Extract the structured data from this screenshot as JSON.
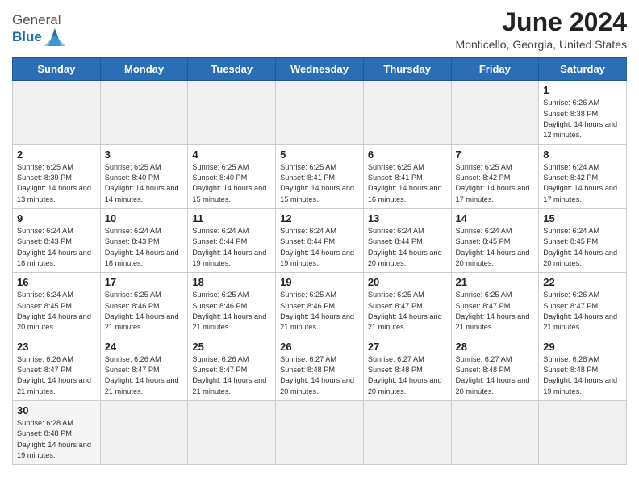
{
  "header": {
    "logo_general": "General",
    "logo_blue": "Blue",
    "month_title": "June 2024",
    "location": "Monticello, Georgia, United States"
  },
  "weekdays": [
    "Sunday",
    "Monday",
    "Tuesday",
    "Wednesday",
    "Thursday",
    "Friday",
    "Saturday"
  ],
  "weeks": [
    [
      {
        "day": "",
        "empty": true
      },
      {
        "day": "",
        "empty": true
      },
      {
        "day": "",
        "empty": true
      },
      {
        "day": "",
        "empty": true
      },
      {
        "day": "",
        "empty": true
      },
      {
        "day": "",
        "empty": true
      },
      {
        "day": "1",
        "sunrise": "Sunrise: 6:26 AM",
        "sunset": "Sunset: 8:38 PM",
        "daylight": "Daylight: 14 hours and 12 minutes."
      }
    ],
    [
      {
        "day": "2",
        "sunrise": "Sunrise: 6:25 AM",
        "sunset": "Sunset: 8:39 PM",
        "daylight": "Daylight: 14 hours and 13 minutes."
      },
      {
        "day": "3",
        "sunrise": "Sunrise: 6:25 AM",
        "sunset": "Sunset: 8:40 PM",
        "daylight": "Daylight: 14 hours and 14 minutes."
      },
      {
        "day": "4",
        "sunrise": "Sunrise: 6:25 AM",
        "sunset": "Sunset: 8:40 PM",
        "daylight": "Daylight: 14 hours and 15 minutes."
      },
      {
        "day": "5",
        "sunrise": "Sunrise: 6:25 AM",
        "sunset": "Sunset: 8:41 PM",
        "daylight": "Daylight: 14 hours and 15 minutes."
      },
      {
        "day": "6",
        "sunrise": "Sunrise: 6:25 AM",
        "sunset": "Sunset: 8:41 PM",
        "daylight": "Daylight: 14 hours and 16 minutes."
      },
      {
        "day": "7",
        "sunrise": "Sunrise: 6:25 AM",
        "sunset": "Sunset: 8:42 PM",
        "daylight": "Daylight: 14 hours and 17 minutes."
      },
      {
        "day": "8",
        "sunrise": "Sunrise: 6:24 AM",
        "sunset": "Sunset: 8:42 PM",
        "daylight": "Daylight: 14 hours and 17 minutes."
      }
    ],
    [
      {
        "day": "9",
        "sunrise": "Sunrise: 6:24 AM",
        "sunset": "Sunset: 8:43 PM",
        "daylight": "Daylight: 14 hours and 18 minutes."
      },
      {
        "day": "10",
        "sunrise": "Sunrise: 6:24 AM",
        "sunset": "Sunset: 8:43 PM",
        "daylight": "Daylight: 14 hours and 18 minutes."
      },
      {
        "day": "11",
        "sunrise": "Sunrise: 6:24 AM",
        "sunset": "Sunset: 8:44 PM",
        "daylight": "Daylight: 14 hours and 19 minutes."
      },
      {
        "day": "12",
        "sunrise": "Sunrise: 6:24 AM",
        "sunset": "Sunset: 8:44 PM",
        "daylight": "Daylight: 14 hours and 19 minutes."
      },
      {
        "day": "13",
        "sunrise": "Sunrise: 6:24 AM",
        "sunset": "Sunset: 8:44 PM",
        "daylight": "Daylight: 14 hours and 20 minutes."
      },
      {
        "day": "14",
        "sunrise": "Sunrise: 6:24 AM",
        "sunset": "Sunset: 8:45 PM",
        "daylight": "Daylight: 14 hours and 20 minutes."
      },
      {
        "day": "15",
        "sunrise": "Sunrise: 6:24 AM",
        "sunset": "Sunset: 8:45 PM",
        "daylight": "Daylight: 14 hours and 20 minutes."
      }
    ],
    [
      {
        "day": "16",
        "sunrise": "Sunrise: 6:24 AM",
        "sunset": "Sunset: 8:45 PM",
        "daylight": "Daylight: 14 hours and 20 minutes."
      },
      {
        "day": "17",
        "sunrise": "Sunrise: 6:25 AM",
        "sunset": "Sunset: 8:46 PM",
        "daylight": "Daylight: 14 hours and 21 minutes."
      },
      {
        "day": "18",
        "sunrise": "Sunrise: 6:25 AM",
        "sunset": "Sunset: 8:46 PM",
        "daylight": "Daylight: 14 hours and 21 minutes."
      },
      {
        "day": "19",
        "sunrise": "Sunrise: 6:25 AM",
        "sunset": "Sunset: 8:46 PM",
        "daylight": "Daylight: 14 hours and 21 minutes."
      },
      {
        "day": "20",
        "sunrise": "Sunrise: 6:25 AM",
        "sunset": "Sunset: 8:47 PM",
        "daylight": "Daylight: 14 hours and 21 minutes."
      },
      {
        "day": "21",
        "sunrise": "Sunrise: 6:25 AM",
        "sunset": "Sunset: 8:47 PM",
        "daylight": "Daylight: 14 hours and 21 minutes."
      },
      {
        "day": "22",
        "sunrise": "Sunrise: 6:26 AM",
        "sunset": "Sunset: 8:47 PM",
        "daylight": "Daylight: 14 hours and 21 minutes."
      }
    ],
    [
      {
        "day": "23",
        "sunrise": "Sunrise: 6:26 AM",
        "sunset": "Sunset: 8:47 PM",
        "daylight": "Daylight: 14 hours and 21 minutes."
      },
      {
        "day": "24",
        "sunrise": "Sunrise: 6:26 AM",
        "sunset": "Sunset: 8:47 PM",
        "daylight": "Daylight: 14 hours and 21 minutes."
      },
      {
        "day": "25",
        "sunrise": "Sunrise: 6:26 AM",
        "sunset": "Sunset: 8:47 PM",
        "daylight": "Daylight: 14 hours and 21 minutes."
      },
      {
        "day": "26",
        "sunrise": "Sunrise: 6:27 AM",
        "sunset": "Sunset: 8:48 PM",
        "daylight": "Daylight: 14 hours and 20 minutes."
      },
      {
        "day": "27",
        "sunrise": "Sunrise: 6:27 AM",
        "sunset": "Sunset: 8:48 PM",
        "daylight": "Daylight: 14 hours and 20 minutes."
      },
      {
        "day": "28",
        "sunrise": "Sunrise: 6:27 AM",
        "sunset": "Sunset: 8:48 PM",
        "daylight": "Daylight: 14 hours and 20 minutes."
      },
      {
        "day": "29",
        "sunrise": "Sunrise: 6:28 AM",
        "sunset": "Sunset: 8:48 PM",
        "daylight": "Daylight: 14 hours and 19 minutes."
      }
    ],
    [
      {
        "day": "30",
        "sunrise": "Sunrise: 6:28 AM",
        "sunset": "Sunset: 8:48 PM",
        "daylight": "Daylight: 14 hours and 19 minutes."
      },
      {
        "day": "",
        "empty": true
      },
      {
        "day": "",
        "empty": true
      },
      {
        "day": "",
        "empty": true
      },
      {
        "day": "",
        "empty": true
      },
      {
        "day": "",
        "empty": true
      },
      {
        "day": "",
        "empty": true
      }
    ]
  ]
}
